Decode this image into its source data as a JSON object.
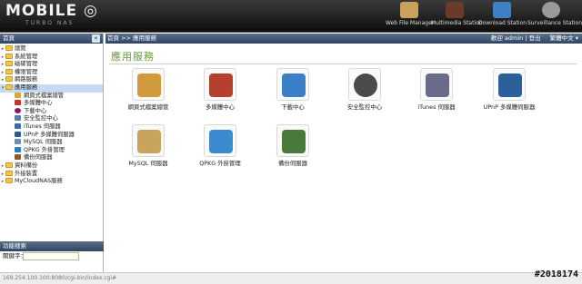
{
  "brand": {
    "logo_text": "MOBILE",
    "logo_sub": "TURBO NAS"
  },
  "top_apps": [
    {
      "label": "Web File Manager",
      "icon": "web-file-manager-icon",
      "color": "#c9a15a"
    },
    {
      "label": "Multimedia Station",
      "icon": "multimedia-station-icon",
      "color": "#6b3a2a"
    },
    {
      "label": "Download Station",
      "icon": "download-station-icon",
      "color": "#3f7fc4"
    },
    {
      "label": "Surveillance Station",
      "icon": "surveillance-station-icon",
      "color": "#9a9a9a"
    }
  ],
  "left": {
    "header": "首頁",
    "tree": [
      {
        "label": "總覽",
        "expanded": false
      },
      {
        "label": "系統管理",
        "expanded": false
      },
      {
        "label": "磁碟管理",
        "expanded": false
      },
      {
        "label": "權限管理",
        "expanded": false
      },
      {
        "label": "網路服務",
        "expanded": false
      },
      {
        "label": "應用服務",
        "expanded": true,
        "selected": true
      }
    ],
    "children": [
      {
        "label": "網頁式檔案總管",
        "color": "#d8a540"
      },
      {
        "label": "多媒體中心",
        "color": "#c0392b"
      },
      {
        "label": "下載中心",
        "color": "#8e1a5a"
      },
      {
        "label": "安全監控中心",
        "color": "#5a7aa8"
      },
      {
        "label": "iTunes 伺服器",
        "color": "#3a6ea5"
      },
      {
        "label": "UPnP 多媒體伺服器",
        "color": "#2a5d8a"
      },
      {
        "label": "MySQL 伺服器",
        "color": "#6b8fb0"
      },
      {
        "label": "QPKG 外掛管理",
        "color": "#2d7bc4"
      },
      {
        "label": "備份伺服器",
        "color": "#8a5a2a"
      }
    ],
    "tree_after": [
      {
        "label": "資料備份"
      },
      {
        "label": "外接裝置"
      },
      {
        "label": "MyCloudNAS服務"
      }
    ],
    "search_header": "功能搜索",
    "search_label": "關鍵字：",
    "search_value": ""
  },
  "main": {
    "crumb": "首頁 >> 應用服務",
    "welcome": "歡迎 admin | 登出",
    "lang": "繁體中文",
    "section_title": "應用服務",
    "apps": [
      {
        "label": "網頁式檔案總管",
        "icon": "web-file-manager-icon",
        "color": "#d19a3c"
      },
      {
        "label": "多媒體中心",
        "icon": "multimedia-center-icon",
        "color": "#b5402e"
      },
      {
        "label": "下載中心",
        "icon": "download-center-icon",
        "color": "#3a7fc8"
      },
      {
        "label": "安全監控中心",
        "icon": "surveillance-camera-icon",
        "color": "#4a4a4a"
      },
      {
        "label": "iTunes 伺服器",
        "icon": "itunes-server-icon",
        "color": "#6a6a8a"
      },
      {
        "label": "UPnP 多媒體伺服器",
        "icon": "upnp-server-icon",
        "color": "#2d5f9a"
      },
      {
        "label": "MySQL 伺服器",
        "icon": "mysql-server-icon",
        "color": "#c8a45a"
      },
      {
        "label": "QPKG 外掛管理",
        "icon": "qpkg-manager-icon",
        "color": "#3c8ad0"
      },
      {
        "label": "備份伺服器",
        "icon": "backup-server-icon",
        "color": "#4a7a3a"
      }
    ]
  },
  "status_url": "169.254.100.100:8080/cgi-bin/index.cgi#",
  "stamp": "#2018174"
}
